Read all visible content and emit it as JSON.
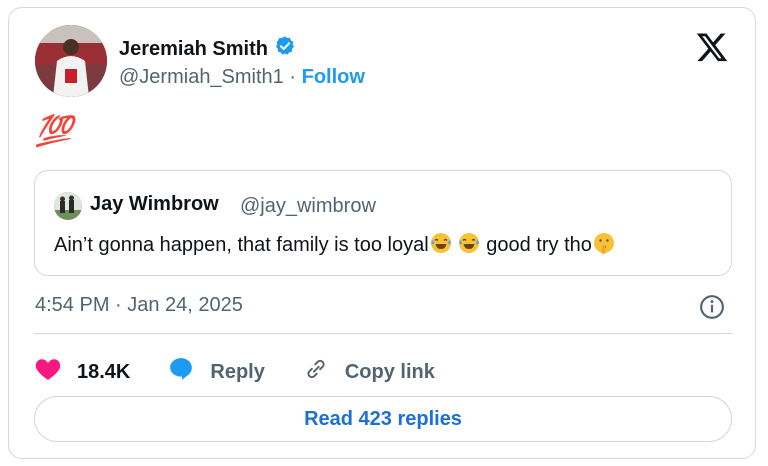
{
  "author": {
    "name": "Jeremiah Smith",
    "handle": "@Jermiah_Smith1",
    "separator": "·",
    "follow_label": "Follow"
  },
  "post": {
    "text": "💯",
    "timestamp": "4:54 PM · Jan 24, 2025"
  },
  "quoted": {
    "name": "Jay Wimbrow",
    "handle": "@jay_wimbrow",
    "text_before": "Ain’t gonna happen, that family is too loyal",
    "text_after": " good try tho"
  },
  "actions": {
    "like_count": "18.4K",
    "reply_label": "Reply",
    "copy_label": "Copy link"
  },
  "read_replies_label": "Read 423 replies",
  "colors": {
    "accent": "#1d9bf0",
    "heart": "#f91880",
    "verified": "#1d9bf0"
  }
}
